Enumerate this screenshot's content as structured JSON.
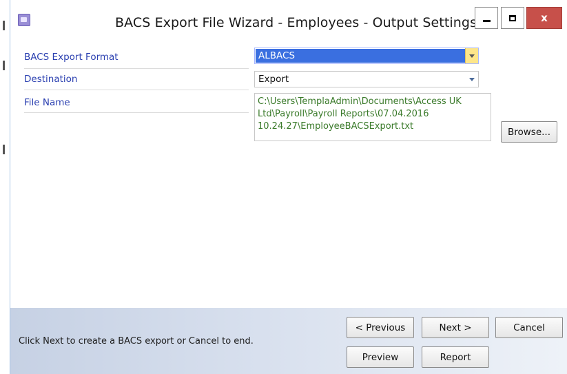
{
  "window": {
    "title": "BACS Export File Wizard - Employees - Output Settings",
    "close_glyph": "x"
  },
  "form": {
    "export_format": {
      "label": "BACS Export Format",
      "value": "ALBACS"
    },
    "destination": {
      "label": "Destination",
      "value": "Export"
    },
    "file_name": {
      "label": "File Name",
      "value": "C:\\Users\\TemplaAdmin\\Documents\\Access UK Ltd\\Payroll\\Payroll Reports\\07.04.2016 10.24.27\\EmployeeBACSExport.txt"
    },
    "browse_label": "Browse..."
  },
  "footer": {
    "hint": "Click Next to create a BACS export or Cancel to end.",
    "previous_label": "< Previous",
    "next_label": "Next >",
    "cancel_label": "Cancel",
    "preview_label": "Preview",
    "report_label": "Report"
  },
  "colors": {
    "label_blue": "#2a3fb0",
    "filename_green": "#3a7a2a",
    "selection_blue": "#3a6fe0",
    "close_red": "#c7504a"
  },
  "icons": [
    "app-icon",
    "minimize-icon",
    "maximize-icon",
    "close-icon",
    "dropdown-arrow-icon"
  ]
}
